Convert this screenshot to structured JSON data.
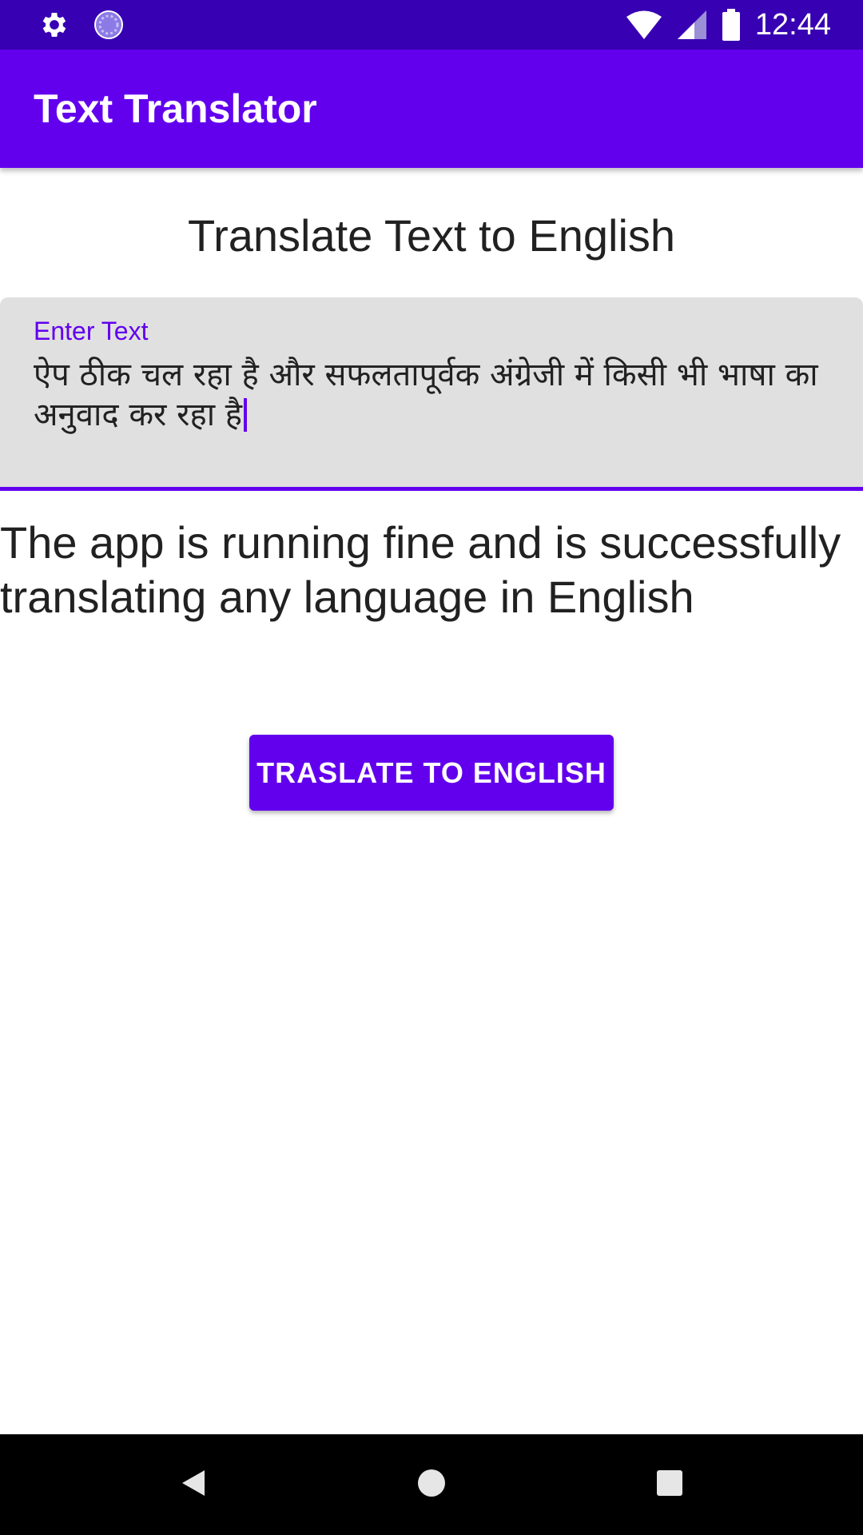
{
  "status_bar": {
    "time": "12:44",
    "left_icons": [
      "settings-icon",
      "loading-icon"
    ],
    "right_icons": [
      "wifi-icon",
      "signal-icon",
      "battery-icon"
    ],
    "background": "#3700b3"
  },
  "app_bar": {
    "title": "Text Translator",
    "background": "#6200ee"
  },
  "main": {
    "heading": "Translate Text to English",
    "input": {
      "label": "Enter Text",
      "value": "ऐप ठीक चल रहा है और सफलतापूर्वक अंग्रेजी में किसी भी भाषा का अनुवाद कर रहा है"
    },
    "output_text": "The app is running fine and is successfully translating any language in English",
    "translate_button_label": "TRASLATE TO ENGLISH"
  },
  "nav_bar": {
    "buttons": [
      "back-icon",
      "home-icon",
      "recents-icon"
    ]
  },
  "colors": {
    "primary": "#6200ee",
    "primary_dark": "#3700b3",
    "field_background": "#e0e0e0"
  }
}
